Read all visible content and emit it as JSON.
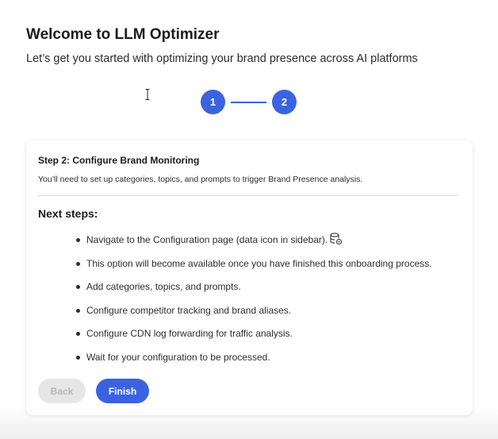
{
  "header": {
    "title": "Welcome to LLM Optimizer",
    "subtitle": "Let’s get you started with optimizing your brand presence across AI platforms"
  },
  "stepper": {
    "steps": [
      {
        "label": "1",
        "active": true
      },
      {
        "label": "2",
        "active": true
      }
    ],
    "accent_color": "#3b63e0"
  },
  "card": {
    "title": "Step 2: Configure Brand Monitoring",
    "description": "You’ll need to set up categories, topics, and prompts to trigger Brand Presence analysis.",
    "next_steps_title": "Next steps:",
    "items": [
      {
        "text": "Navigate to the Configuration page (data icon in sidebar).",
        "icon": "database-settings-icon"
      },
      {
        "text": "This option will become available once you have finished this onboarding process."
      },
      {
        "text": "Add categories, topics, and prompts."
      },
      {
        "text": "Configure competitor tracking and brand aliases."
      },
      {
        "text": "Configure CDN log forwarding for traffic analysis."
      },
      {
        "text": "Wait for your configuration to be processed."
      }
    ]
  },
  "footer": {
    "back_label": "Back",
    "back_disabled": true,
    "finish_label": "Finish"
  }
}
